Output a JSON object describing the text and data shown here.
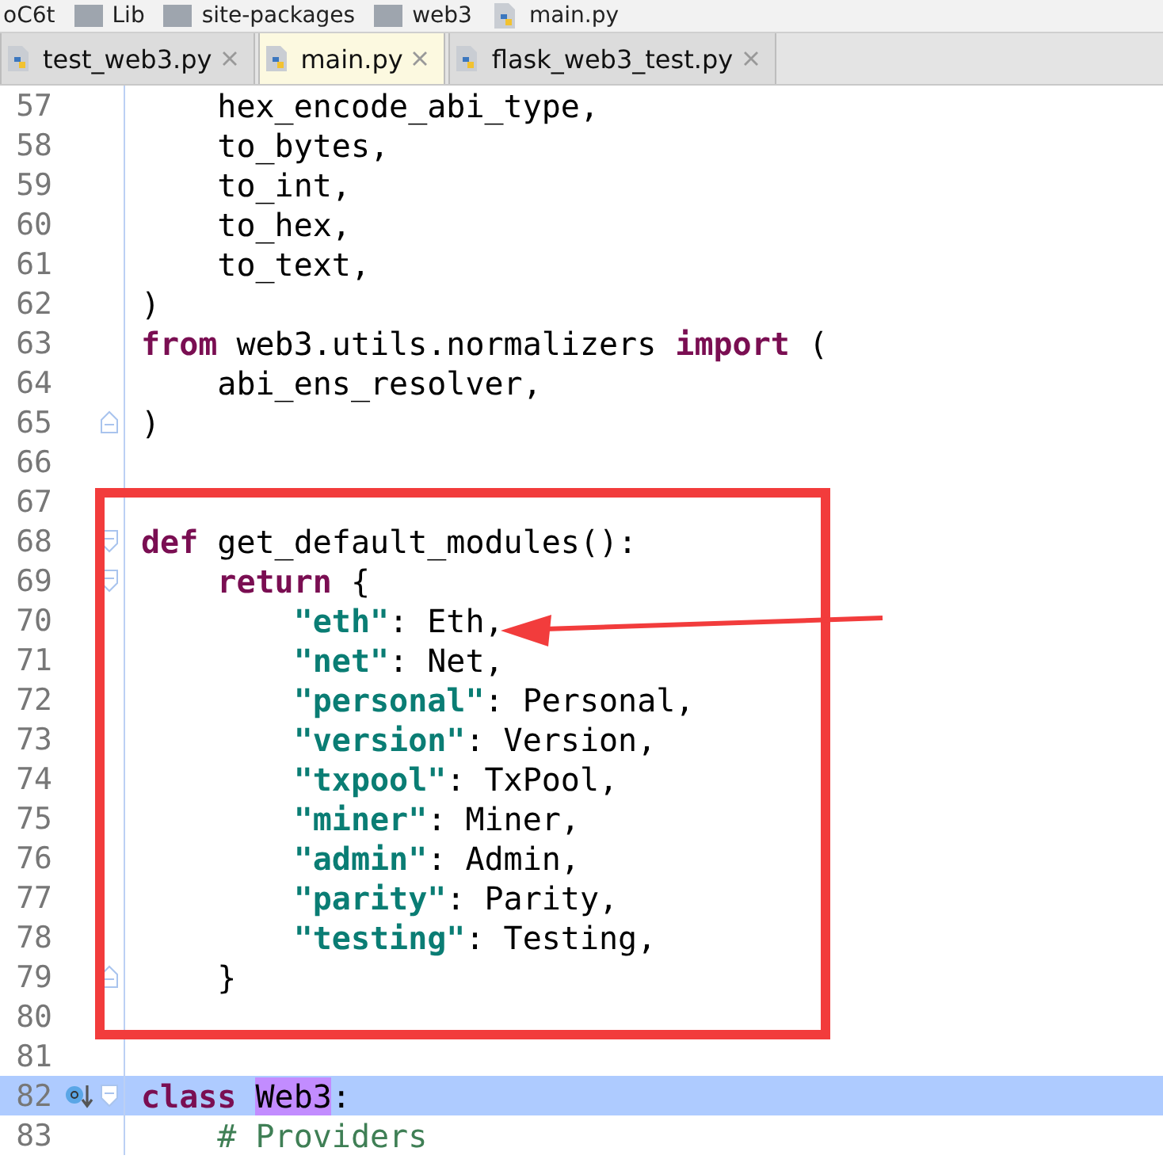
{
  "breadcrumb": [
    {
      "label": "oC6t",
      "kind": "text"
    },
    {
      "label": "Lib",
      "kind": "folder"
    },
    {
      "label": "site-packages",
      "kind": "folder"
    },
    {
      "label": "web3",
      "kind": "folder"
    },
    {
      "label": "main.py",
      "kind": "python"
    }
  ],
  "tabs": [
    {
      "label": "test_web3.py",
      "selected": false
    },
    {
      "label": "main.py",
      "selected": true
    },
    {
      "label": "flask_web3_test.py",
      "selected": false
    }
  ],
  "lines": [
    {
      "number": "57",
      "tokens": [
        {
          "kind": "plain",
          "text": "    hex_encode_abi_type,"
        }
      ]
    },
    {
      "number": "58",
      "tokens": [
        {
          "kind": "plain",
          "text": "    to_bytes,"
        }
      ]
    },
    {
      "number": "59",
      "tokens": [
        {
          "kind": "plain",
          "text": "    to_int,"
        }
      ]
    },
    {
      "number": "60",
      "tokens": [
        {
          "kind": "plain",
          "text": "    to_hex,"
        }
      ]
    },
    {
      "number": "61",
      "tokens": [
        {
          "kind": "plain",
          "text": "    to_text,"
        }
      ]
    },
    {
      "number": "62",
      "tokens": [
        {
          "kind": "plain",
          "text": ")"
        }
      ]
    },
    {
      "number": "63",
      "tokens": [
        {
          "kind": "kw",
          "text": "from"
        },
        {
          "kind": "plain",
          "text": " web3.utils.normalizers "
        },
        {
          "kind": "kw",
          "text": "import"
        },
        {
          "kind": "plain",
          "text": " ("
        }
      ]
    },
    {
      "number": "64",
      "tokens": [
        {
          "kind": "plain",
          "text": "    abi_ens_resolver,"
        }
      ]
    },
    {
      "number": "65",
      "fold_end": true,
      "tokens": [
        {
          "kind": "plain",
          "text": ")"
        }
      ]
    },
    {
      "number": "66"
    },
    {
      "number": "67"
    },
    {
      "number": "68",
      "fold_start": true,
      "tokens": [
        {
          "kind": "kw",
          "text": "def"
        },
        {
          "kind": "plain",
          "text": " get_default_modules():"
        }
      ]
    },
    {
      "number": "69",
      "fold_start": true,
      "tokens": [
        {
          "kind": "kw",
          "text": "    return"
        },
        {
          "kind": "plain",
          "text": " {"
        }
      ]
    },
    {
      "number": "70",
      "tokens": [
        {
          "kind": "str",
          "text": "        \"eth\""
        },
        {
          "kind": "plain",
          "text": ": Eth,"
        }
      ]
    },
    {
      "number": "71",
      "tokens": [
        {
          "kind": "str",
          "text": "        \"net\""
        },
        {
          "kind": "plain",
          "text": ": Net,"
        }
      ]
    },
    {
      "number": "72",
      "tokens": [
        {
          "kind": "str",
          "text": "        \"personal\""
        },
        {
          "kind": "plain",
          "text": ": Personal,"
        }
      ]
    },
    {
      "number": "73",
      "tokens": [
        {
          "kind": "str",
          "text": "        \"version\""
        },
        {
          "kind": "plain",
          "text": ": Version,"
        }
      ]
    },
    {
      "number": "74",
      "tokens": [
        {
          "kind": "str",
          "text": "        \"txpool\""
        },
        {
          "kind": "plain",
          "text": ": TxPool,"
        }
      ]
    },
    {
      "number": "75",
      "tokens": [
        {
          "kind": "str",
          "text": "        \"miner\""
        },
        {
          "kind": "plain",
          "text": ": Miner,"
        }
      ]
    },
    {
      "number": "76",
      "tokens": [
        {
          "kind": "str",
          "text": "        \"admin\""
        },
        {
          "kind": "plain",
          "text": ": Admin,"
        }
      ]
    },
    {
      "number": "77",
      "tokens": [
        {
          "kind": "str",
          "text": "        \"parity\""
        },
        {
          "kind": "plain",
          "text": ": Parity,"
        }
      ]
    },
    {
      "number": "78",
      "tokens": [
        {
          "kind": "str",
          "text": "        \"testing\""
        },
        {
          "kind": "plain",
          "text": ": Testing,"
        }
      ]
    },
    {
      "number": "79",
      "fold_end": true,
      "tokens": [
        {
          "kind": "plain",
          "text": "    }"
        }
      ]
    },
    {
      "number": "80"
    },
    {
      "number": "81"
    },
    {
      "number": "82",
      "fold_start": true,
      "current": true,
      "marker": true,
      "tokens": [
        {
          "kind": "kw",
          "text": "class "
        },
        {
          "kind": "match",
          "text": "Web3"
        },
        {
          "kind": "plain",
          "text": ":"
        }
      ]
    },
    {
      "number": "83",
      "tokens": [
        {
          "kind": "comment",
          "text": "    # Providers"
        }
      ]
    }
  ]
}
